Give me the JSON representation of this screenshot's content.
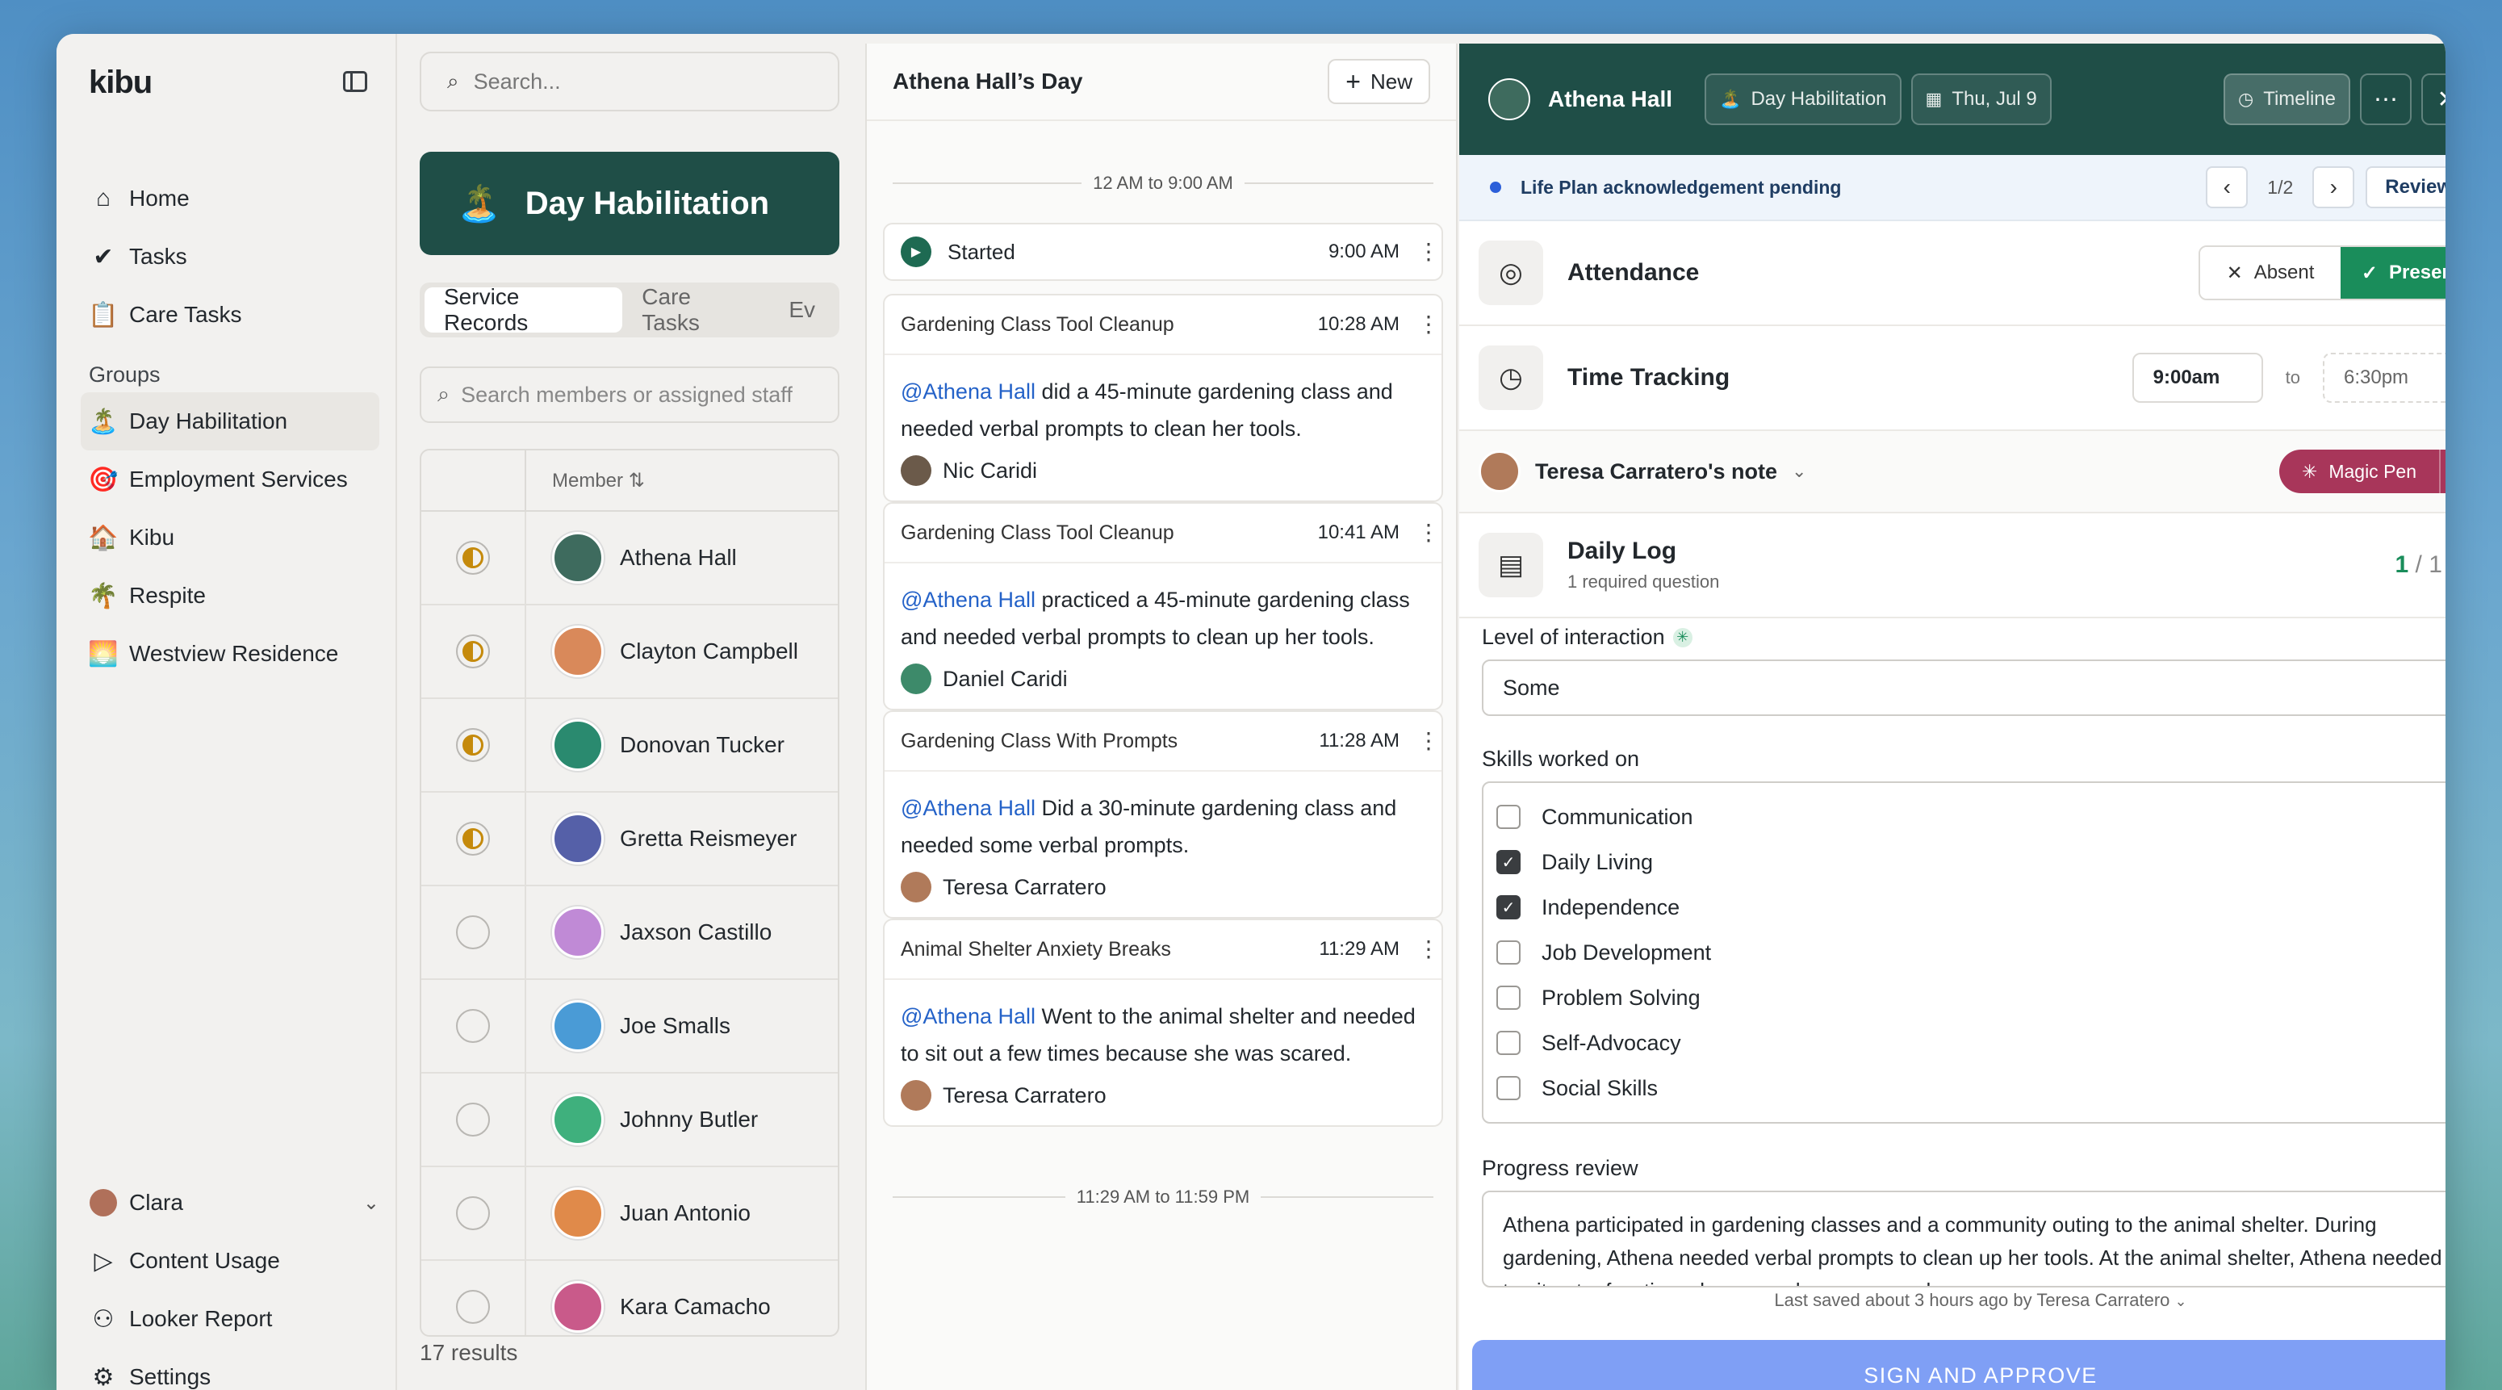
{
  "sidebar": {
    "logo": "kibu",
    "nav": [
      {
        "label": "Home",
        "icon": "home-icon"
      },
      {
        "label": "Tasks",
        "icon": "tasks-icon"
      },
      {
        "label": "Care Tasks",
        "icon": "clipboard-icon"
      }
    ],
    "groups_title": "Groups",
    "groups": [
      {
        "label": "Day Habilitation",
        "emoji": "🏝️"
      },
      {
        "label": "Employment Services",
        "emoji": "🎯"
      },
      {
        "label": "Kibu",
        "emoji": "🏠"
      },
      {
        "label": "Respite",
        "emoji": "🌴"
      },
      {
        "label": "Westview Residence",
        "emoji": "🌅"
      }
    ],
    "bottom": [
      {
        "label": "Clara",
        "icon": "user-avatar"
      },
      {
        "label": "Content Usage",
        "icon": "play-icon"
      },
      {
        "label": "Looker Report",
        "icon": "looker-icon"
      },
      {
        "label": "Settings",
        "icon": "gear-icon"
      }
    ]
  },
  "list": {
    "search_placeholder": "Search...",
    "group_title": "Day Habilitation",
    "group_emoji": "🏝️",
    "tabs": [
      "Service Records",
      "Care Tasks",
      "Ev"
    ],
    "member_search_placeholder": "Search members or assigned staff",
    "column_member": "Member ⇅",
    "members": [
      {
        "name": "Athena Hall",
        "status": "half",
        "color": "#3e6b5e"
      },
      {
        "name": "Clayton Campbell",
        "status": "half",
        "color": "#d9895a"
      },
      {
        "name": "Donovan Tucker",
        "status": "half",
        "color": "#2a8a6f"
      },
      {
        "name": "Gretta Reismeyer",
        "status": "half",
        "color": "#5560a8"
      },
      {
        "name": "Jaxson Castillo",
        "status": "empty",
        "color": "#c08ad6"
      },
      {
        "name": "Joe Smalls",
        "status": "empty",
        "color": "#4a9bd6"
      },
      {
        "name": "Johnny Butler",
        "status": "empty",
        "color": "#3fb07d"
      },
      {
        "name": "Juan Antonio",
        "status": "empty",
        "color": "#e08a4a"
      },
      {
        "name": "Kara Camacho",
        "status": "empty",
        "color": "#c95a8a"
      }
    ],
    "results": "17 results"
  },
  "day": {
    "title": "Athena Hall’s Day",
    "new_label": "New",
    "range_start": "12 AM to 9:00 AM",
    "started_label": "Started",
    "started_time": "9:00 AM",
    "notes": [
      {
        "title": "Gardening Class Tool Cleanup",
        "time": "10:28 AM",
        "mention": "@Athena Hall",
        "text": " did a 45-minute gardening class and needed verbal prompts to clean her tools.",
        "author": "Nic Caridi",
        "author_color": "#6b5a4a"
      },
      {
        "title": "Gardening Class Tool Cleanup",
        "time": "10:41 AM",
        "mention": "@Athena Hall",
        "text": " practiced a 45-minute gardening class and needed verbal prompts to clean up her tools.",
        "author": "Daniel Caridi",
        "author_color": "#3d8a6a"
      },
      {
        "title": "Gardening Class With Prompts",
        "time": "11:28 AM",
        "mention": "@Athena Hall",
        "text": " Did a 30-minute gardening class and needed some verbal prompts.",
        "author": "Teresa Carratero",
        "author_color": "#b07a5a"
      },
      {
        "title": "Animal Shelter Anxiety Breaks",
        "time": "11:29 AM",
        "mention": "@Athena Hall",
        "text": " Went to the animal shelter and needed to sit out a few times because she was scared.",
        "author": "Teresa Carratero",
        "author_color": "#b07a5a"
      }
    ],
    "range_end": "11:29 AM to 11:59 PM"
  },
  "detail": {
    "name": "Athena Hall",
    "group_pill": "Day Habilitation",
    "date_pill": "Thu, Jul 9",
    "timeline_label": "Timeline",
    "alert": "Life Plan acknowledgement pending",
    "pager": "1/2",
    "review_label": "Review",
    "attendance_title": "Attendance",
    "absent_label": "Absent",
    "present_label": "Present",
    "time_title": "Time Tracking",
    "time_start": "9:00am",
    "time_to": "to",
    "time_end": "6:30pm",
    "note_owner": "Teresa Carratero's note",
    "magic_pen": "Magic Pen",
    "log_title": "Daily Log",
    "log_sub": "1 required question",
    "log_done": "1",
    "log_total": " / 1",
    "interaction_label": "Level of interaction",
    "interaction_value": "Some",
    "skills_label": "Skills worked on",
    "skills": [
      {
        "label": "Communication",
        "checked": false
      },
      {
        "label": "Daily Living",
        "checked": true
      },
      {
        "label": "Independence",
        "checked": true
      },
      {
        "label": "Job Development",
        "checked": false
      },
      {
        "label": "Problem Solving",
        "checked": false
      },
      {
        "label": "Self-Advocacy",
        "checked": false
      },
      {
        "label": "Social Skills",
        "checked": false
      }
    ],
    "progress_label": "Progress review",
    "progress_text": "Athena participated in gardening classes and a community outing to the animal shelter. During gardening, Athena needed verbal prompts to clean up her tools. At the animal shelter, Athena needed to sit out a few times because she was scared.",
    "saved_text": "Last saved about 3 hours ago by Teresa Carratero",
    "sign_label": "SIGN AND APPROVE"
  }
}
